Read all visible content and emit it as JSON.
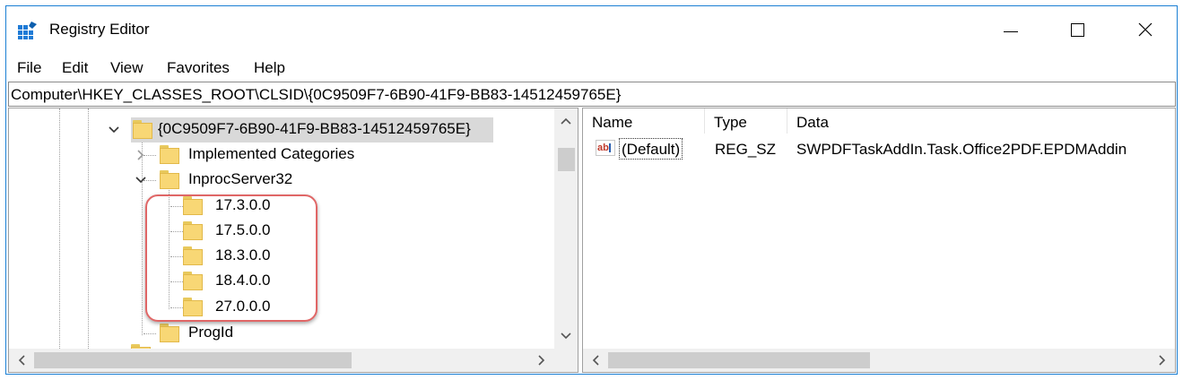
{
  "window": {
    "title": "Registry Editor",
    "controls": {
      "minimize": "minimize",
      "maximize": "maximize",
      "close": "close"
    }
  },
  "menu": [
    "File",
    "Edit",
    "View",
    "Favorites",
    "Help"
  ],
  "address": "Computer\\HKEY_CLASSES_ROOT\\CLSID\\{0C9509F7-6B90-41F9-BB83-14512459765E}",
  "tree": {
    "selected": "{0C9509F7-6B90-41F9-BB83-14512459765E}",
    "items": [
      {
        "label": "{0C9509F7-6B90-41F9-BB83-14512459765E}",
        "expander": "chevron-down",
        "selected": true
      },
      {
        "label": "Implemented Categories",
        "expander": "chevron-right"
      },
      {
        "label": "InprocServer32",
        "expander": "chevron-down"
      },
      {
        "label": "17.3.0.0"
      },
      {
        "label": "17.5.0.0"
      },
      {
        "label": "18.3.0.0"
      },
      {
        "label": "18.4.0.0"
      },
      {
        "label": "27.0.0.0"
      },
      {
        "label": "ProgId"
      }
    ]
  },
  "list": {
    "columns": [
      "Name",
      "Type",
      "Data"
    ],
    "rows": [
      {
        "name": "(Default)",
        "type": "REG_SZ",
        "data": "SWPDFTaskAddIn.Task.Office2PDF.EPDMAddin",
        "icon": "string-value-icon"
      }
    ]
  },
  "annotation": {
    "color": "#e06666"
  },
  "colors": {
    "window_border": "#1a7fd4",
    "folder": "#f8d775",
    "selection": "#d9d9d9"
  }
}
